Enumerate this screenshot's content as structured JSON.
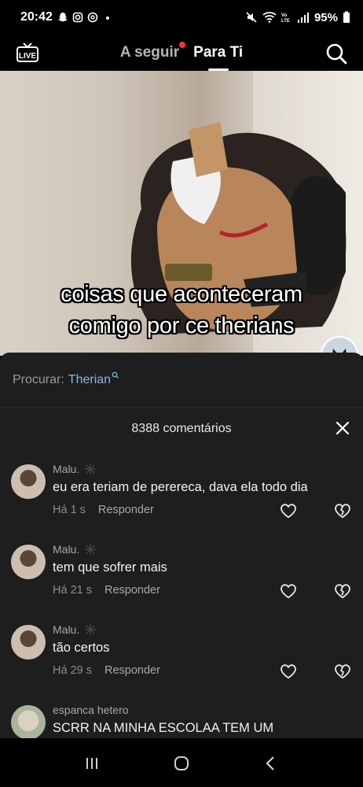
{
  "status": {
    "time": "20:42",
    "battery": "95%"
  },
  "nav": {
    "following": "A seguir",
    "for_you": "Para Ti"
  },
  "video": {
    "caption_line1": "coisas que aconteceram",
    "caption_line2": "comigo por ce therians"
  },
  "comments_sheet": {
    "search_label": "Procurar:",
    "search_term": "Therian",
    "count_label": "8388 comentários",
    "reply_label": "Responder",
    "comments": [
      {
        "user": "Malu.",
        "text": "eu era teriam de perereca, dava ela todo dia",
        "time": "Há 1 s"
      },
      {
        "user": "Malu.",
        "text": "tem que sofrer mais",
        "time": "Há 21 s"
      },
      {
        "user": "Malu.",
        "text": "tão certos",
        "time": "Há 29 s"
      },
      {
        "user": "espanca hetero",
        "text": "SCRR NA MINHA ESCOLAA TEM UM",
        "time": ""
      }
    ]
  },
  "colors": {
    "accent_red": "#fe2c55",
    "search_link": "#8ab7e8",
    "sheet_bg": "#1e1e1e"
  }
}
